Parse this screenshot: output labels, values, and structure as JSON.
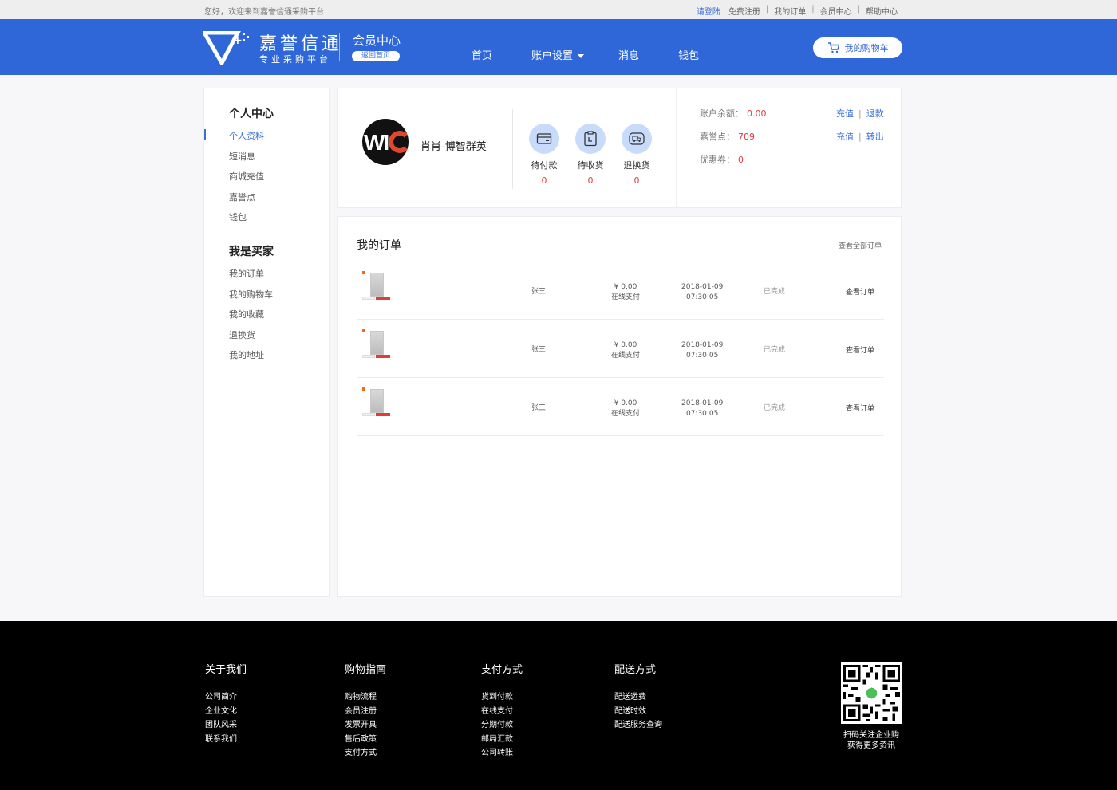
{
  "topbar": {
    "welcome": "您好，欢迎来到嘉誉信通采购平台",
    "links": [
      "请登陆",
      "免费注册",
      "我的订单",
      "会员中心",
      "帮助中心"
    ]
  },
  "header": {
    "brand_name": "嘉誉信通",
    "brand_sub": "专业采购平台",
    "member_title": "会员中心",
    "back_home": "返回首页",
    "nav": [
      "首页",
      "账户设置",
      "消息",
      "钱包"
    ],
    "cart_label": "我的购物车",
    "colors": {
      "primary": "#2f67d8",
      "accent_red": "#e23b3b"
    }
  },
  "sidebar": {
    "section1": "个人中心",
    "items1": [
      "个人资料",
      "短消息",
      "商城充值",
      "嘉誉点",
      "钱包"
    ],
    "section2": "我是买家",
    "items2": [
      "我的订单",
      "我的购物车",
      "我的收藏",
      "退换货",
      "我的地址"
    ]
  },
  "profile": {
    "avatar_text": "WI",
    "username": "肖肖-博智群英",
    "stats": [
      {
        "label": "待付款",
        "count": "0",
        "icon": "card-icon"
      },
      {
        "label": "待收货",
        "count": "0",
        "icon": "clipboard-icon"
      },
      {
        "label": "退换货",
        "count": "0",
        "icon": "truck-icon"
      }
    ],
    "account": [
      {
        "label": "账户余额：",
        "value": "0.00",
        "actions": [
          "充值",
          "退款"
        ]
      },
      {
        "label": "嘉誉点：",
        "value": "709",
        "actions": [
          "充值",
          "转出"
        ]
      },
      {
        "label": "优惠券：",
        "value": "0",
        "actions": []
      }
    ]
  },
  "orders": {
    "title": "我的订单",
    "view_all": "查看全部订单",
    "rows": [
      {
        "buyer": "张三",
        "price": "¥ 0.00",
        "pay": "在线支付",
        "date": "2018-01-09",
        "time": "07:30:05",
        "status": "已完成",
        "action": "查看订单"
      },
      {
        "buyer": "张三",
        "price": "¥ 0.00",
        "pay": "在线支付",
        "date": "2018-01-09",
        "time": "07:30:05",
        "status": "已完成",
        "action": "查看订单"
      },
      {
        "buyer": "张三",
        "price": "¥ 0.00",
        "pay": "在线支付",
        "date": "2018-01-09",
        "time": "07:30:05",
        "status": "已完成",
        "action": "查看订单"
      }
    ]
  },
  "footer": {
    "columns": [
      {
        "title": "关于我们",
        "items": [
          "公司简介",
          "企业文化",
          "团队风采",
          "联系我们"
        ]
      },
      {
        "title": "购物指南",
        "items": [
          "购物流程",
          "会员注册",
          "发票开具",
          "售后政策",
          "支付方式"
        ]
      },
      {
        "title": "支付方式",
        "items": [
          "货到付款",
          "在线支付",
          "分期付款",
          "邮局汇款",
          "公司转账"
        ]
      },
      {
        "title": "配送方式",
        "items": [
          "配送运费",
          "配送时效",
          "配送服务查询"
        ]
      }
    ],
    "qr_caption_1": "扫码关注企业购",
    "qr_caption_2": "获得更多资讯"
  }
}
